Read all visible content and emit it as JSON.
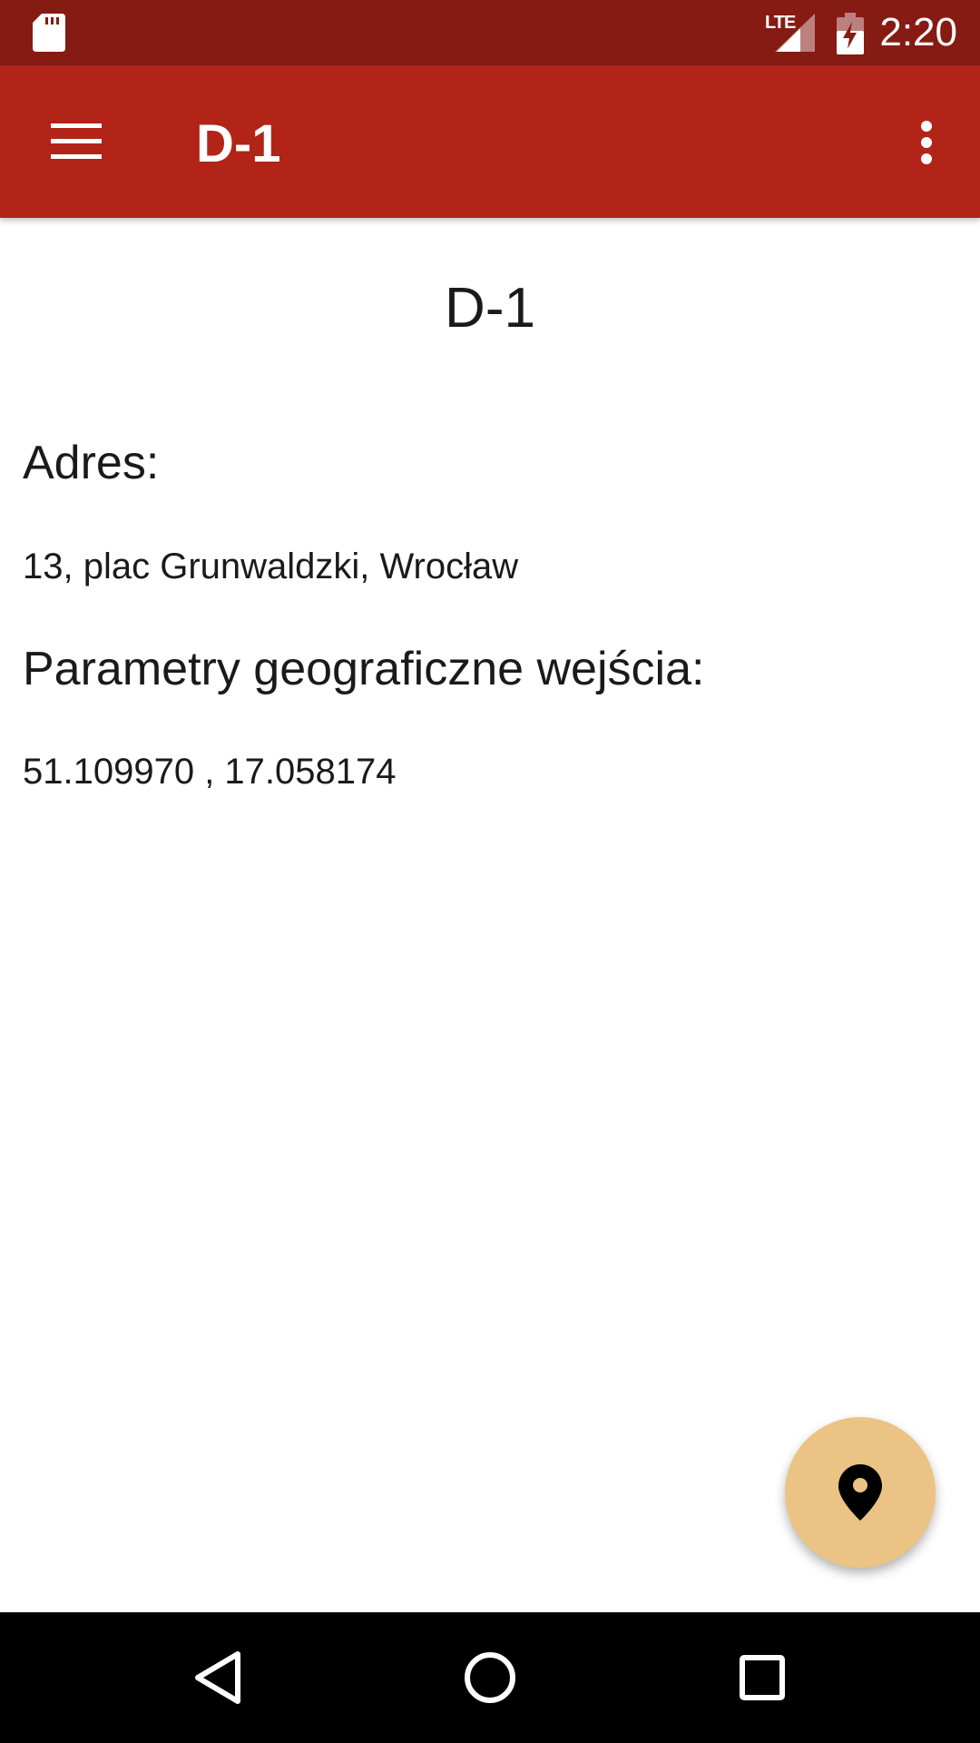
{
  "status_bar": {
    "network_type": "LTE",
    "time": "2:20",
    "icons": [
      "sd-card-icon",
      "signal-icon",
      "battery-charging-icon"
    ]
  },
  "app_bar": {
    "title": "D-1",
    "icons": [
      "hamburger-menu-icon",
      "overflow-menu-icon"
    ]
  },
  "content": {
    "heading": "D-1",
    "address_label": "Adres:",
    "address_value": "13, plac Grunwaldzki, Wrocław",
    "geo_label": "Parametry geograficzne wejścia:",
    "geo_value": "51.109970 , 17.058174"
  },
  "fab": {
    "icon": "location-pin-icon",
    "color": "#ebc384"
  },
  "nav_bar": {
    "icons": [
      "back-icon",
      "home-icon",
      "recents-icon"
    ]
  },
  "colors": {
    "status_bar": "#861b14",
    "app_bar": "#b22318",
    "fab": "#ebc384"
  }
}
